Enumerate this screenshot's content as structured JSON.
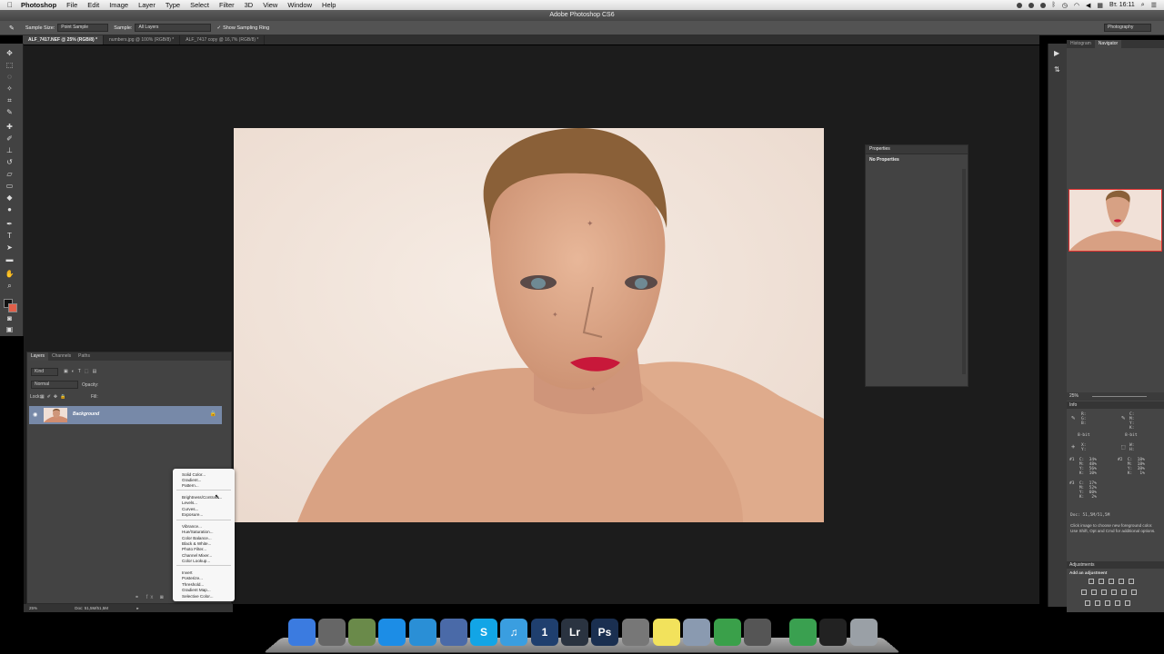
{
  "menubar": {
    "app": "Photoshop",
    "items": [
      "File",
      "Edit",
      "Image",
      "Layer",
      "Type",
      "Select",
      "Filter",
      "3D",
      "View",
      "Window",
      "Help"
    ],
    "clock": "Вт. 16:11"
  },
  "window_title": "Adobe Photoshop CS6",
  "options": {
    "sample_size_label": "Sample Size:",
    "sample_size_value": "Point Sample",
    "sample_label": "Sample:",
    "sample_value": "All Layers",
    "show_ring": "Show Sampling Ring",
    "workspace": "Photography"
  },
  "tabs": [
    {
      "label": "ALF_7417.NEF @ 25% (RGB/8) *",
      "active": true
    },
    {
      "label": "numbers.jpg @ 100% (RGB/8) *",
      "active": false
    },
    {
      "label": "ALF_7417 copy @ 16,7% (RGB/8) *",
      "active": false
    }
  ],
  "properties": {
    "title": "Properties",
    "empty": "No Properties"
  },
  "right_panel": {
    "tabs": [
      "Histogram",
      "Navigator"
    ],
    "zoom": "25%",
    "info_title": "Info",
    "info_rgb": "R:\nG:\nB:",
    "info_cmyk": "C:\nM:\nY:\nK:",
    "info_bit1": "8-bit",
    "info_bit2": "8-bit",
    "info_xy": "X:\nY:",
    "info_wh": "W:\nH:",
    "s1": "#1  C:  34%\n    M:  48%\n    Y:  56%\n    K:  10%",
    "s2": "#2  C:  18%\n    M:  18%\n    Y:  38%\n    K:   1%",
    "s3": "#3  C:  17%\n    M:  52%\n    Y:  60%\n    K:   2%",
    "doc": "Doc: 51,5M/51,5M",
    "hint": "Click image to choose new foreground color. Use Shift, Opt and Cmd for additional options.",
    "adj_title": "Adjustments",
    "adj_sub": "Add an adjustment"
  },
  "layers": {
    "tabs": [
      "Layers",
      "Channels",
      "Paths"
    ],
    "kind": "Kind",
    "blend": "Normal",
    "opacity": "Opacity:",
    "lock": "Lock:",
    "fill": "Fill:",
    "layer_name": "Background"
  },
  "status": {
    "zoom": "25%",
    "doc": "Doc: 51,5M/51,5M"
  },
  "popup_items": [
    "Solid Color...",
    "Gradient...",
    "Pattern...",
    "Brightness/Contrast...",
    "Levels...",
    "Curves...",
    "Exposure...",
    "Vibrance...",
    "Hue/Saturation...",
    "Color Balance...",
    "Black & White...",
    "Photo Filter...",
    "Channel Mixer...",
    "Color Lookup...",
    "Invert",
    "Posterize...",
    "Threshold...",
    "Gradient Map...",
    "Selective Color..."
  ],
  "dock": [
    {
      "name": "finder",
      "label": "",
      "color": "#3b7be0"
    },
    {
      "name": "launchpad",
      "label": "",
      "color": "#666"
    },
    {
      "name": "mail",
      "label": "",
      "color": "#6a8a4a"
    },
    {
      "name": "app-store",
      "label": "",
      "color": "#1c8de6"
    },
    {
      "name": "safari",
      "label": "",
      "color": "#2a8fd6"
    },
    {
      "name": "preview",
      "label": "",
      "color": "#4a6aa8"
    },
    {
      "name": "skype",
      "label": "S",
      "color": "#12a5e6"
    },
    {
      "name": "itunes",
      "label": "♫",
      "color": "#3a9ee0"
    },
    {
      "name": "onepassword",
      "label": "1",
      "color": "#1f3f6e"
    },
    {
      "name": "lightroom",
      "label": "Lr",
      "color": "#2a3340"
    },
    {
      "name": "photoshop",
      "label": "Ps",
      "color": "#1a2f50"
    },
    {
      "name": "system-prefs",
      "label": "",
      "color": "#777"
    },
    {
      "name": "stickies",
      "label": "",
      "color": "#f2e25c"
    },
    {
      "name": "network",
      "label": "",
      "color": "#8a9ab0"
    },
    {
      "name": "adium",
      "label": "",
      "color": "#3aa04a"
    },
    {
      "name": "imovie",
      "label": "",
      "color": "#555"
    },
    {
      "name": "contacts",
      "label": "",
      "color": "#3aa050"
    },
    {
      "name": "terminal",
      "label": "",
      "color": "#222"
    },
    {
      "name": "trash",
      "label": "",
      "color": "#9aa0a6"
    }
  ]
}
